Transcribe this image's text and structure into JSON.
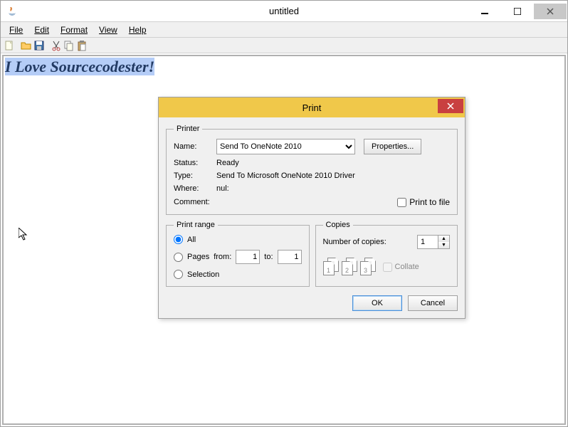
{
  "window": {
    "title": "untitled"
  },
  "menu": {
    "file": "File",
    "edit": "Edit",
    "format": "Format",
    "view": "View",
    "help": "Help"
  },
  "editor": {
    "text": "I Love Sourcecodester!"
  },
  "dialog": {
    "title": "Print",
    "printer_group": "Printer",
    "name_label": "Name:",
    "printer_name": "Send To OneNote 2010",
    "properties_btn": "Properties...",
    "status_label": "Status:",
    "status_value": "Ready",
    "type_label": "Type:",
    "type_value": "Send To Microsoft OneNote 2010 Driver",
    "where_label": "Where:",
    "where_value": "nul:",
    "comment_label": "Comment:",
    "print_to_file": "Print to file",
    "range_group": "Print range",
    "range_all": "All",
    "range_pages": "Pages",
    "range_from": "from:",
    "range_to": "to:",
    "range_from_val": "1",
    "range_to_val": "1",
    "range_selection": "Selection",
    "copies_group": "Copies",
    "copies_label": "Number of copies:",
    "copies_value": "1",
    "collate": "Collate",
    "page_label_1": "1",
    "page_label_2": "2",
    "page_label_3": "3",
    "ok": "OK",
    "cancel": "Cancel"
  }
}
